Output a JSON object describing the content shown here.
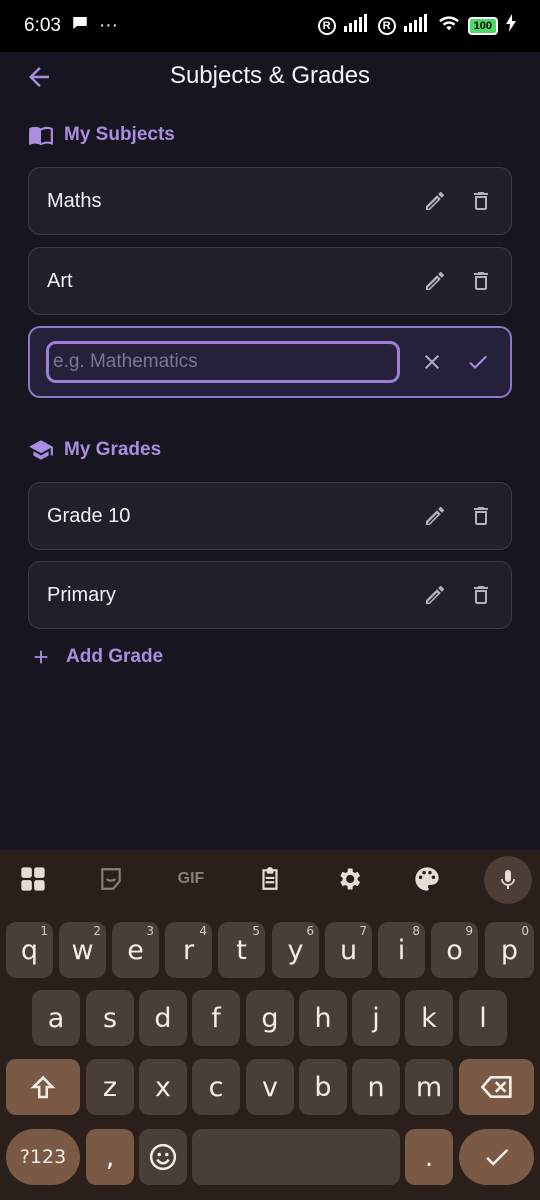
{
  "status": {
    "time": "6:03",
    "more": "···",
    "battery": "100"
  },
  "header": {
    "title": "Subjects & Grades"
  },
  "subjects": {
    "heading": "My Subjects",
    "items": [
      {
        "label": "Maths"
      },
      {
        "label": "Art"
      }
    ],
    "new_placeholder": "e.g. Mathematics"
  },
  "grades": {
    "heading": "My Grades",
    "items": [
      {
        "label": "Grade 10"
      },
      {
        "label": "Primary"
      }
    ],
    "add_label": "Add Grade"
  },
  "keyboard": {
    "toolbar": [
      "apps-icon",
      "sticker-icon",
      "gif-icon",
      "clipboard-icon",
      "settings-icon",
      "palette-icon",
      "mic-icon"
    ],
    "gif_label": "GIF",
    "row1": [
      {
        "k": "q",
        "h": "1"
      },
      {
        "k": "w",
        "h": "2"
      },
      {
        "k": "e",
        "h": "3"
      },
      {
        "k": "r",
        "h": "4"
      },
      {
        "k": "t",
        "h": "5"
      },
      {
        "k": "y",
        "h": "6"
      },
      {
        "k": "u",
        "h": "7"
      },
      {
        "k": "i",
        "h": "8"
      },
      {
        "k": "o",
        "h": "9"
      },
      {
        "k": "p",
        "h": "0"
      }
    ],
    "row2": [
      "a",
      "s",
      "d",
      "f",
      "g",
      "h",
      "j",
      "k",
      "l"
    ],
    "row3": [
      "z",
      "x",
      "c",
      "v",
      "b",
      "n",
      "m"
    ],
    "sym_label": "?123",
    "comma": ",",
    "period": "."
  },
  "colors": {
    "accent": "#a98de0",
    "background": "#17151f",
    "card": "#221f2d",
    "keyboard_bg": "#2a1f1a",
    "key": "#4a3f38",
    "key_mod": "#7a5a45"
  }
}
